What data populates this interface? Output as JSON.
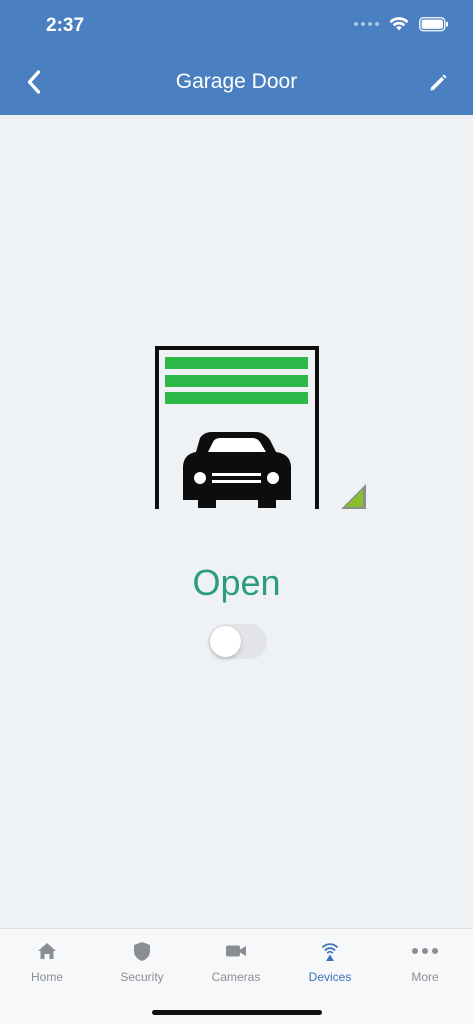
{
  "status_bar": {
    "time": "2:37"
  },
  "nav": {
    "title": "Garage Door",
    "back_icon": "chevron-left-icon",
    "edit_icon": "pencil-icon"
  },
  "device": {
    "status": "Open",
    "toggle_on": false,
    "accent_color": "#2b9c80",
    "door_panel_color": "#2fb84a"
  },
  "tabs": [
    {
      "label": "Home",
      "icon": "home-icon",
      "active": false
    },
    {
      "label": "Security",
      "icon": "shield-icon",
      "active": false
    },
    {
      "label": "Cameras",
      "icon": "video-camera-icon",
      "active": false
    },
    {
      "label": "Devices",
      "icon": "wireless-device-icon",
      "active": true
    },
    {
      "label": "More",
      "icon": "more-dots-icon",
      "active": false
    }
  ],
  "colors": {
    "header": "#4a7fc1",
    "background": "#eff2f5",
    "active_tab": "#3b73b9",
    "inactive_tab": "#8a8e93"
  }
}
